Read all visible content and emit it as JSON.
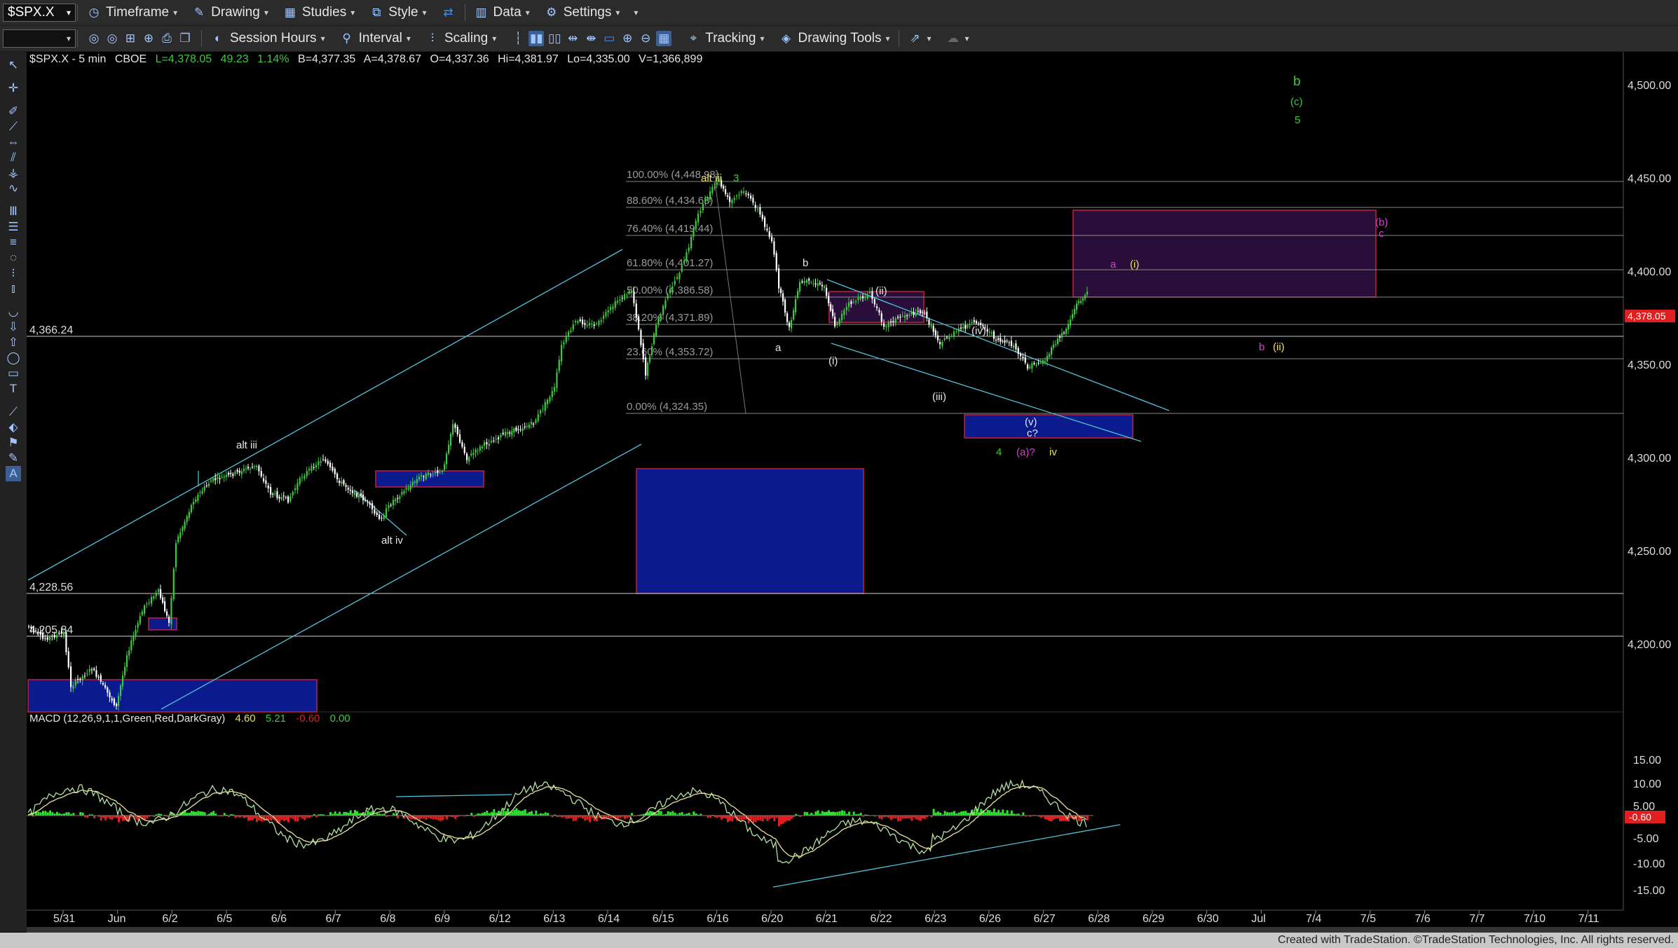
{
  "toolbar": {
    "symbol": "$SPX.X",
    "timeframe": "Timeframe",
    "drawing": "Drawing",
    "studies": "Studies",
    "style": "Style",
    "data": "Data",
    "settings": "Settings",
    "session_hours": "Session Hours",
    "interval": "Interval",
    "scaling": "Scaling",
    "tracking": "Tracking",
    "drawing_tools": "Drawing Tools"
  },
  "header": {
    "symbol": "$SPX.X - 5 min",
    "exchange": "CBOE",
    "last": "L=4,378.05",
    "change": "49.23",
    "pct": "1.14%",
    "bid": "B=4,377.35",
    "ask": "A=4,378.67",
    "open": "O=4,337.36",
    "high": "Hi=4,381.97",
    "low": "Lo=4,335.00",
    "volume": "V=1,366,899"
  },
  "price_axis": {
    "ticks": [
      "4,500.00",
      "4,450.00",
      "4,400.00",
      "4,350.00",
      "4,300.00",
      "4,250.00",
      "4,200.00"
    ],
    "last_badge": "4,378.05",
    "macd_badge": "-0.60"
  },
  "macd_axis": {
    "ticks": [
      "15.00",
      "10.00",
      "5.00",
      "-5.00",
      "-10.00",
      "-15.00"
    ]
  },
  "level_labels": {
    "l1": "4,366.24",
    "l2": "4,228.56",
    "l3": "4,205.84"
  },
  "fib": [
    "100.00% (4,448.98)",
    "88.60% (4,434.63)",
    "76.40% (4,419.44)",
    "61.80% (4,401.27)",
    "50.00% (4,386.58)",
    "38.20% (4,371.89)",
    "23.60% (4,353.72)",
    "0.00% (4,324.35)"
  ],
  "annotations": {
    "alt_iii_top": "alt iii",
    "alt_iii": "alt iii",
    "alt_iv": "alt iv",
    "three": "3",
    "a": "a",
    "b": "b",
    "i": "(i)",
    "ii": "(ii)",
    "iii": "(iii)",
    "iv": "(iv)",
    "v": "(v)",
    "c_q": "c?",
    "four": "4",
    "a_q": "(a)?",
    "iv_small": "iv",
    "g_b": "b",
    "g_c": "(c)",
    "g_5": "5",
    "m_b": "(b)",
    "m_c": "c",
    "m_a": "a",
    "y_i": "(i)",
    "m_b2": "b",
    "y_ii": "(ii)"
  },
  "macd": {
    "label": "MACD (12,26,9,1,1,Green,Red,DarkGray)",
    "v1": "4.60",
    "v2": "5.21",
    "v3": "-0.60",
    "v4": "0.00"
  },
  "date_axis": [
    "5/31",
    "Jun",
    "6/2",
    "6/5",
    "6/6",
    "6/7",
    "6/8",
    "6/9",
    "6/12",
    "6/13",
    "6/14",
    "6/15",
    "6/16",
    "6/20",
    "6/21",
    "6/22",
    "6/23",
    "6/26",
    "6/27",
    "6/28",
    "6/29",
    "6/30",
    "Jul",
    "7/4",
    "7/5",
    "7/6",
    "7/7",
    "7/10",
    "7/11"
  ],
  "footer": "Created with TradeStation. ©TradeStation Technologies, Inc. All rights reserved.",
  "colors": {
    "up": "#3ec93e",
    "down": "#ffffff",
    "channel": "#4fc3d8",
    "box_blue": "#0b1a8c",
    "box_purple": "#2a0e3a",
    "macd_pos": "#2fe02f",
    "macd_neg": "#e02020"
  }
}
